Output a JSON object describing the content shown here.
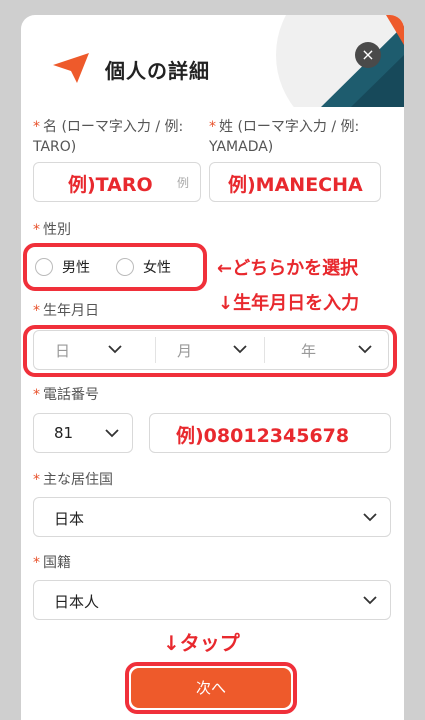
{
  "header": {
    "title": "個人の詳細",
    "close_glyph": "×"
  },
  "fields": {
    "first_name": {
      "label": "名 (ローマ字入力 / 例: TARO)",
      "example": "例)TARO",
      "ghost": "例"
    },
    "last_name": {
      "label": "姓 (ローマ字入力 / 例: YAMADA)",
      "example": "例)MANECHA"
    },
    "gender": {
      "label": "性別",
      "options": [
        "男性",
        "女性"
      ],
      "hint": "←どちらかを選択"
    },
    "birth": {
      "label": "生年月日",
      "hint": "↓生年月日を入力",
      "day": "日",
      "month": "月",
      "year": "年"
    },
    "phone": {
      "label": "電話番号",
      "code": "81",
      "example": "例)08012345678"
    },
    "residence": {
      "label": "主な居住国",
      "value": "日本"
    },
    "nationality": {
      "label": "国籍",
      "value": "日本人"
    }
  },
  "tap_hint": "↓タップ",
  "next_label": "次へ",
  "colors": {
    "accent": "#ee5a2b",
    "annotation_red": "#f0303a",
    "teal": "#1e5c6e"
  }
}
